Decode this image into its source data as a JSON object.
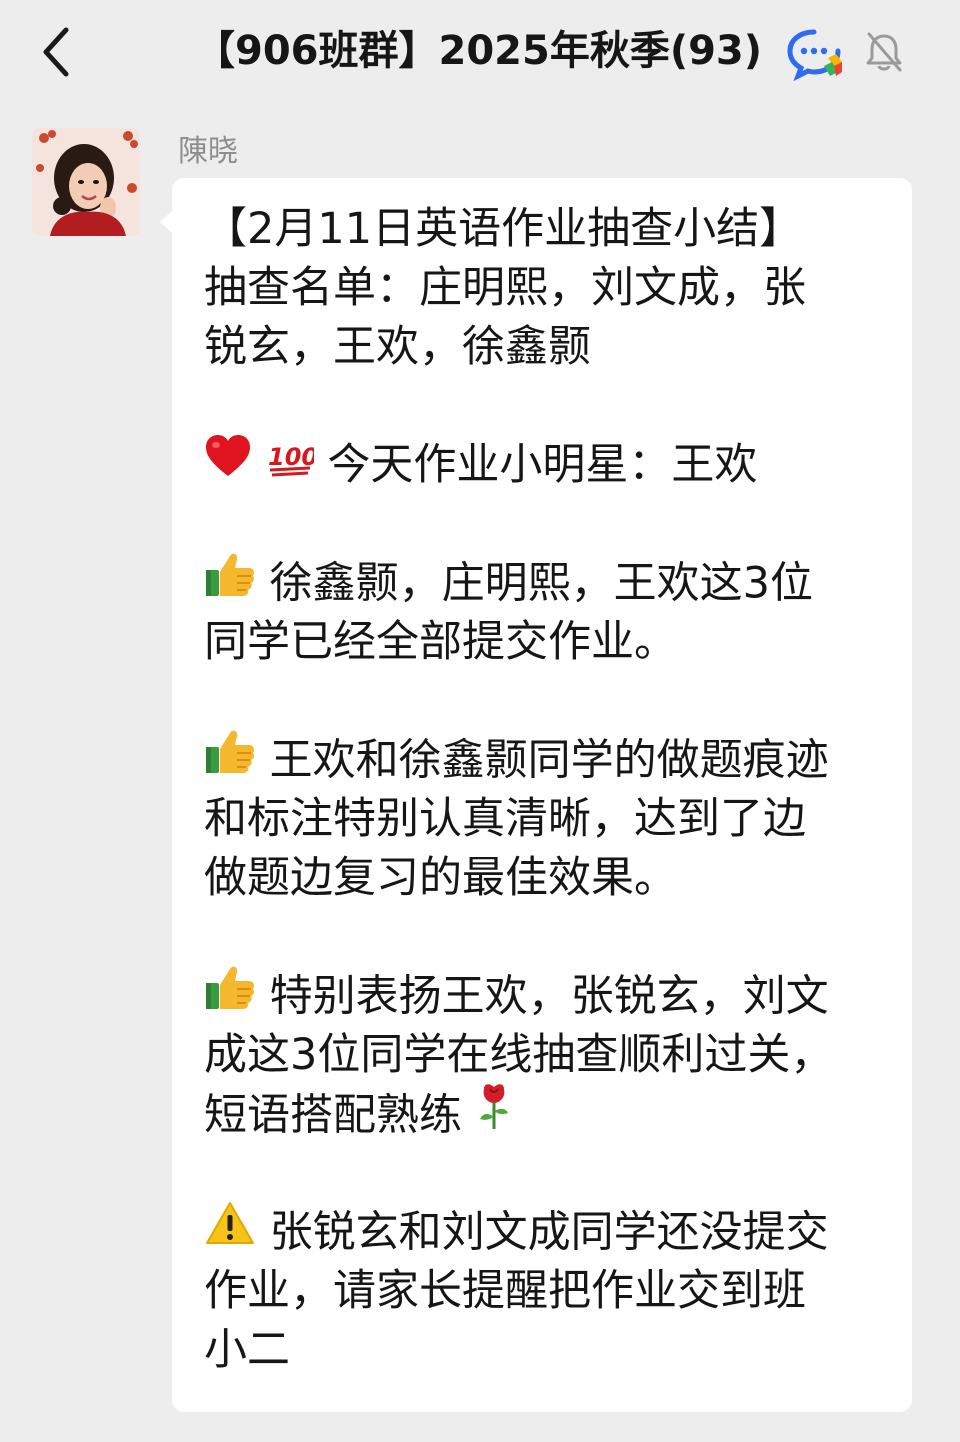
{
  "header": {
    "title": "【906班群】2025年秋季(93)",
    "back_icon": "chevron-left-icon",
    "group_icon": "group-chat-icon",
    "mute_icon": "bell-muted-icon"
  },
  "message": {
    "sender": "陳晓",
    "lines": {
      "l01": "【2月11日英语作业抽查小结】",
      "l02": "抽查名单：庄明熙，刘文成，张",
      "l03": "锐玄，王欢，徐鑫颢",
      "l04": "今天作业小明星：王欢",
      "l05": "徐鑫颢，庄明熙，王欢这3位",
      "l06": "同学已经全部提交作业。",
      "l07": "王欢和徐鑫颢同学的做题痕迹",
      "l08": "和标注特别认真清晰，达到了边",
      "l09": "做题边复习的最佳效果。",
      "l10": "特别表扬王欢，张锐玄，刘文",
      "l11": "成这3位同学在线抽查顺利过关，",
      "l12": "短语搭配熟练",
      "l13": "张锐玄和刘文成同学还没提交",
      "l14": "作业，请家长提醒把作业交到班",
      "l15": "小二"
    },
    "emojis": {
      "heart": "red-heart-emoji",
      "hundred": "hundred-points-emoji",
      "thumbs": "thumbs-up-emoji",
      "rose": "rose-emoji",
      "warning": "warning-emoji"
    },
    "hundred_text": "100"
  },
  "colors": {
    "background": "#ededed",
    "bubble": "#ffffff",
    "text": "#161616",
    "sender": "#8e8e8e"
  }
}
